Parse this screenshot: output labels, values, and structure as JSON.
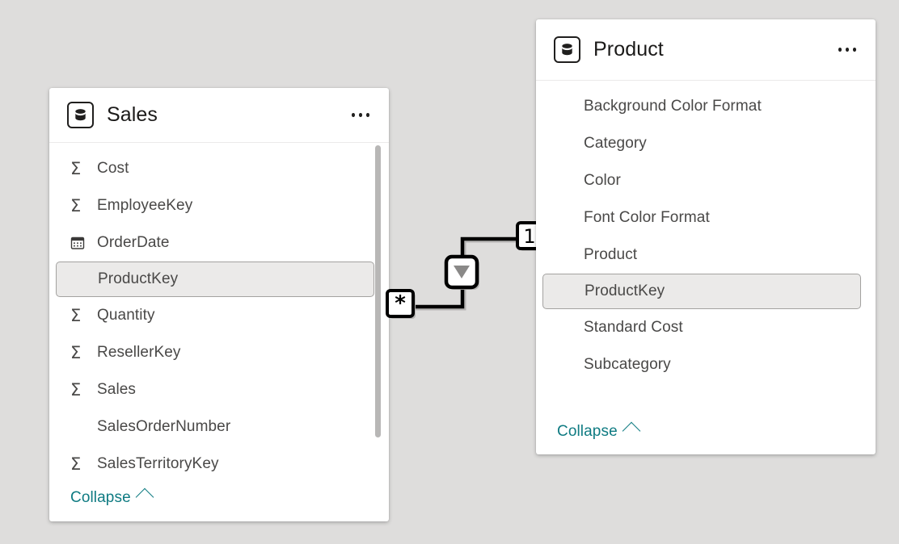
{
  "canvas": {
    "background_color": "#dedddc",
    "accent_color": "#0f7b82",
    "selected_field_bg": "#ebeae9"
  },
  "tables": [
    {
      "name": "Sales",
      "icon": "table-database-icon",
      "more_menu": "more-options",
      "collapse_label": "Collapse",
      "scrollbar": true,
      "fields": [
        {
          "label": "Cost",
          "icon": "sigma-icon",
          "selected": false
        },
        {
          "label": "EmployeeKey",
          "icon": "sigma-icon",
          "selected": false
        },
        {
          "label": "OrderDate",
          "icon": "calendar-icon",
          "selected": false
        },
        {
          "label": "ProductKey",
          "icon": "none",
          "selected": true
        },
        {
          "label": "Quantity",
          "icon": "sigma-icon",
          "selected": false
        },
        {
          "label": "ResellerKey",
          "icon": "sigma-icon",
          "selected": false
        },
        {
          "label": "Sales",
          "icon": "sigma-icon",
          "selected": false
        },
        {
          "label": "SalesOrderNumber",
          "icon": "none",
          "selected": false
        },
        {
          "label": "SalesTerritoryKey",
          "icon": "sigma-icon",
          "selected": false
        }
      ]
    },
    {
      "name": "Product",
      "icon": "table-database-icon",
      "more_menu": "more-options",
      "collapse_label": "Collapse",
      "scrollbar": false,
      "fields": [
        {
          "label": "Background Color Format",
          "icon": "none",
          "selected": false
        },
        {
          "label": "Category",
          "icon": "none",
          "selected": false
        },
        {
          "label": "Color",
          "icon": "none",
          "selected": false
        },
        {
          "label": "Font Color Format",
          "icon": "none",
          "selected": false
        },
        {
          "label": "Product",
          "icon": "none",
          "selected": false
        },
        {
          "label": "ProductKey",
          "icon": "none",
          "selected": true
        },
        {
          "label": "Standard Cost",
          "icon": "none",
          "selected": false
        },
        {
          "label": "Subcategory",
          "icon": "none",
          "selected": false
        }
      ]
    }
  ],
  "relationship": {
    "from_table": "Sales",
    "from_field": "ProductKey",
    "from_cardinality": "*",
    "to_table": "Product",
    "to_field": "ProductKey",
    "to_cardinality": "1",
    "cross_filter_direction": "single",
    "cross_filter_icon": "arrow-down-icon",
    "line_color": "#000000"
  }
}
